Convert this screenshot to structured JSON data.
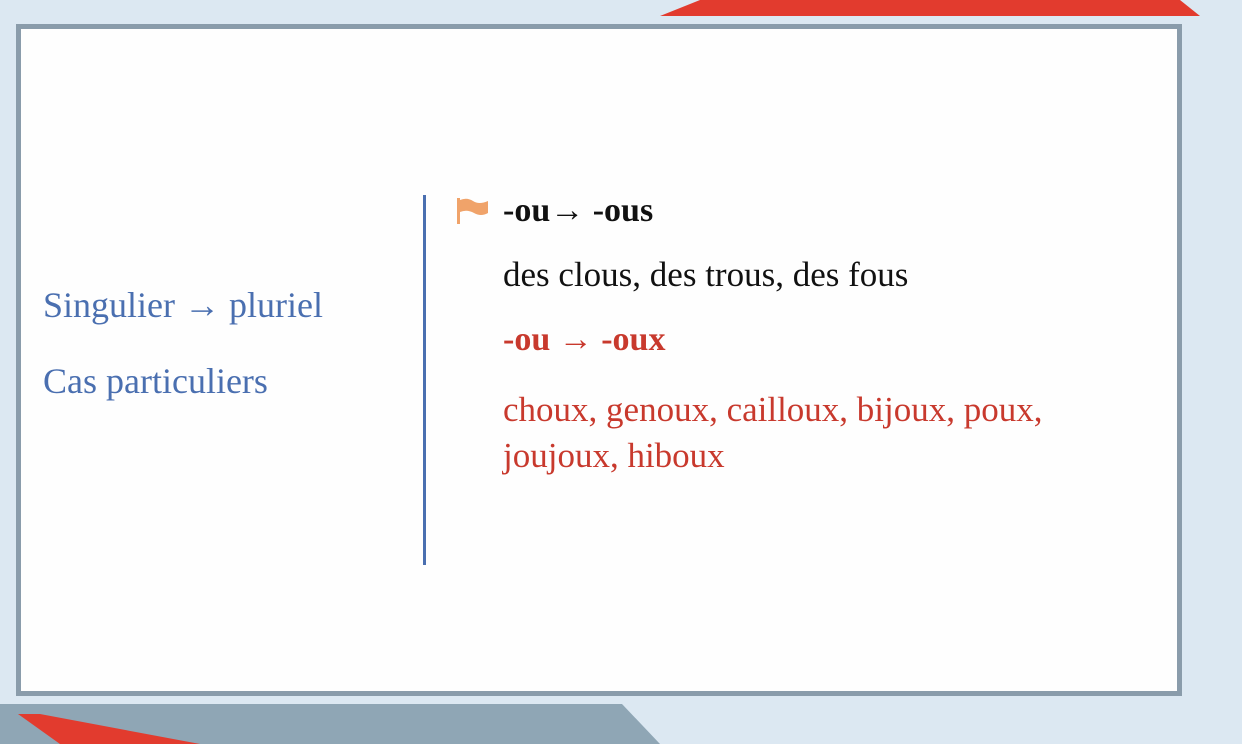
{
  "slide": {
    "left": {
      "line1": "Singulier → pluriel",
      "line2": "Cas particuliers"
    },
    "right": {
      "bullet_icon": "flag-icon",
      "rule1": "-ou→ -ous",
      "examples1": "des clous, des trous, des fous",
      "rule2": "-ou → -oux",
      "examples2": "choux, genoux, cailloux, bijoux, poux, joujoux, hiboux"
    }
  },
  "colors": {
    "heading_blue": "#4a6fb0",
    "accent_red": "#c8392d",
    "frame_gray": "#8a9cab",
    "flag_orange": "#f0a36a"
  }
}
